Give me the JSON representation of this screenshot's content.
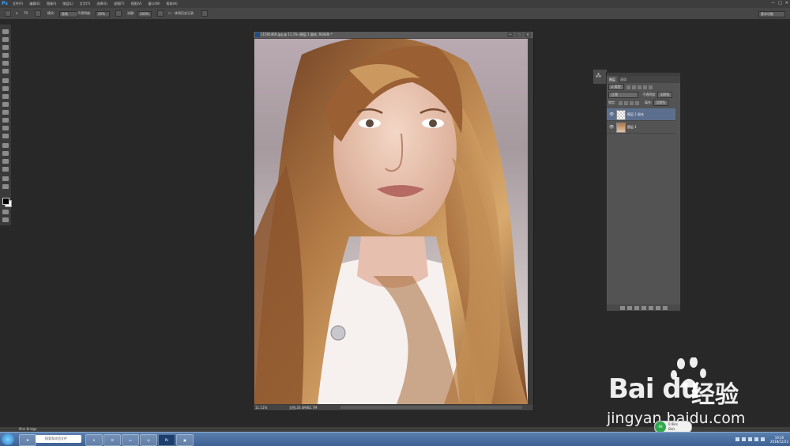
{
  "app": {
    "logo": "Ps",
    "menu": [
      "文件(F)",
      "编辑(E)",
      "图像(I)",
      "图层(L)",
      "文字(Y)",
      "选择(S)",
      "滤镜(T)",
      "视图(V)",
      "窗口(W)",
      "帮助(H)"
    ],
    "window_controls": [
      "—",
      "□",
      "✕"
    ]
  },
  "options_bar": {
    "brush_size": "70",
    "mode_label": "模式:",
    "mode_value": "画笔",
    "opacity_label": "不透明度:",
    "opacity_value": "20%",
    "flow_label": "流量:",
    "flow_value": "100%",
    "history_label": "抹到历史记录",
    "workspace": "基本功能"
  },
  "document": {
    "title": "11591469.jpg @ 11.1% (图层 1 副本, RGB/8) *",
    "zoom": "11.11%",
    "info": "文档:26.4M/82.7M",
    "controls": [
      "—",
      "□",
      "✕"
    ]
  },
  "layers_panel": {
    "tabs": [
      "图层",
      "通道"
    ],
    "filter_label": "ρ 类型",
    "blend_mode": "正常",
    "opacity_label": "不透明度:",
    "opacity_value": "100%",
    "lock_label": "锁定:",
    "fill_label": "填充:",
    "fill_value": "100%",
    "layers": [
      {
        "name": "图层 1 副本",
        "selected": true
      },
      {
        "name": "图层 1",
        "selected": false
      }
    ]
  },
  "status_strip": {
    "label": "Mini Bridge"
  },
  "taskbar": {
    "search_text": "搜索和浏览文件",
    "items": [
      "e",
      "☰",
      "▭",
      "◎",
      "Ps",
      "▣"
    ],
    "clock_time": "19:26",
    "clock_date": "2018/12/22"
  },
  "watermark": {
    "logo_text": "Bai du",
    "jingyan": "经验",
    "url": "jingyan.baidu.com"
  },
  "float_widget": {
    "badge": "69",
    "line1": "0.9k/s",
    "line2": "0k/s"
  }
}
